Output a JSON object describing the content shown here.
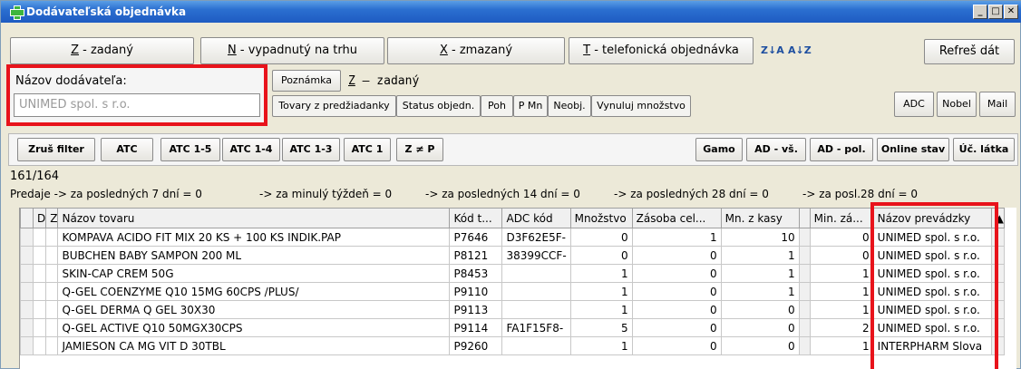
{
  "window": {
    "title": "Dodávateľská objednávka"
  },
  "top_tabs": [
    {
      "prefix": "Z",
      "label": " - zadaný"
    },
    {
      "prefix": "N",
      "label": " - vypadnutý na trhu"
    },
    {
      "prefix": "X",
      "label": " - zmazaný"
    },
    {
      "prefix": "T",
      "label": " - telefonická objednávka"
    }
  ],
  "sort_icons": [
    "Z↓A",
    "A↓Z"
  ],
  "refresh_label": "Refreš dát",
  "supplier": {
    "label": "Názov dodávateľa:",
    "value": "UNIMED spol. s r.o."
  },
  "note": {
    "button": "Poznámka",
    "status_prefix": "Z",
    "status_text": " – zadaný"
  },
  "action_buttons": [
    "Tovary z predžiadanky",
    "Status objedn.",
    "Poh",
    "P Mn",
    "Neobj.",
    "Vynuluj množstvo"
  ],
  "right_buttons": [
    "ADC",
    "Nobel",
    "Mail"
  ],
  "filter_buttons": [
    "Zruš filter",
    "ATC",
    "ATC 1-5",
    "ATC 1-4",
    "ATC 1-3",
    "ATC 1",
    "Z ≠ P"
  ],
  "filter_right_buttons": [
    "Gamo",
    "AD - vš.",
    "AD - pol.",
    "Online stav",
    "Úč. látka"
  ],
  "count": "161/164",
  "sales_info": {
    "prefix": "Predaje -> za posledných 7 dní = 0",
    "w": "-> za minulý týždeň = 0",
    "d14": "-> za posledných 14 dní = 0",
    "d28": "-> za posledných 28 dní = 0",
    "pd28": "-> za posl.28 dní = 0"
  },
  "table": {
    "columns": [
      "D",
      "Z",
      "Názov tovaru",
      "Kód t...",
      "ADC kód",
      "Množstvo",
      "Zásoba cel...",
      "Mn. z kasy",
      "",
      "Min. zá...",
      "Názov prevádzky"
    ],
    "rows": [
      {
        "name": "KOMPAVA ACIDO FIT MIX 20 KS + 100 KS INDIK.PAP",
        "code": "P7646",
        "adc": "D3F62E5F-",
        "qty": "0",
        "stock": "1",
        "kasa": "10",
        "min": "0",
        "shop": "UNIMED spol. s r.o."
      },
      {
        "name": "BUBCHEN BABY SAMPON 200 ML",
        "code": "P8121",
        "adc": "38399CCF-",
        "qty": "0",
        "stock": "0",
        "kasa": "1",
        "min": "0",
        "shop": "UNIMED spol. s r.o."
      },
      {
        "name": "SKIN-CAP CREM 50G",
        "code": "P8453",
        "adc": "",
        "qty": "1",
        "stock": "0",
        "kasa": "1",
        "min": "1",
        "shop": "UNIMED spol. s r.o."
      },
      {
        "name": "Q-GEL COENZYME Q10 15MG 60CPS /PLUS/",
        "code": "P9110",
        "adc": "",
        "qty": "1",
        "stock": "0",
        "kasa": "1",
        "min": "1",
        "shop": "UNIMED spol. s r.o."
      },
      {
        "name": "Q-GEL DERMA Q GEL 30X30",
        "code": "P9113",
        "adc": "",
        "qty": "1",
        "stock": "0",
        "kasa": "0",
        "min": "1",
        "shop": "UNIMED spol. s r.o."
      },
      {
        "name": "Q-GEL ACTIVE Q10 50MGX30CPS",
        "code": "P9114",
        "adc": "FA1F15F8-",
        "qty": "5",
        "stock": "0",
        "kasa": "0",
        "min": "2",
        "shop": "UNIMED spol. s r.o."
      },
      {
        "name": "JAMIESON CA MG VIT D 30TBL",
        "code": "P9260",
        "adc": "",
        "qty": "1",
        "stock": "0",
        "kasa": "0",
        "min": "1",
        "shop": "INTERPHARM Slova"
      }
    ]
  },
  "colors": {
    "highlight": "#e8131b",
    "titlebar": "#2b6fd0"
  }
}
